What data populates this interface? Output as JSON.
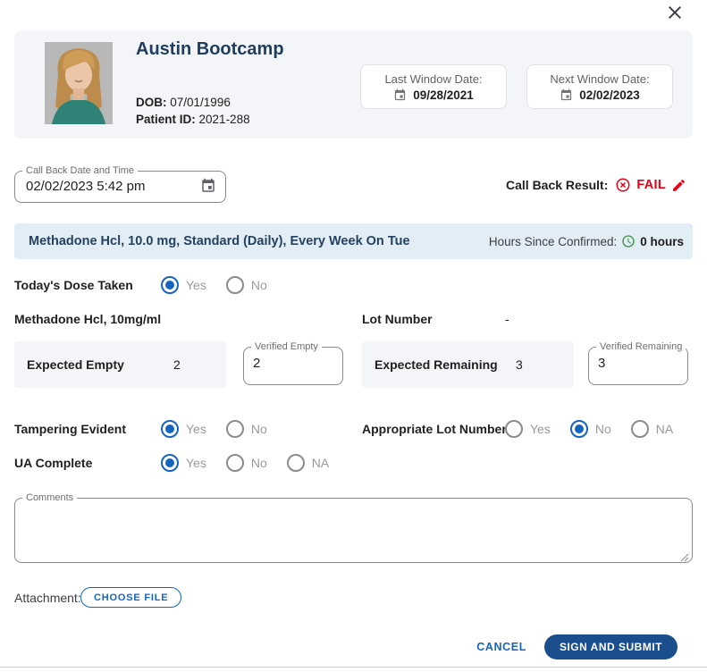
{
  "patient": {
    "name": "Austin Bootcamp",
    "dob_label": "DOB:",
    "dob_value": "07/01/1996",
    "patient_id_label": "Patient ID:",
    "patient_id_value": "2021-288",
    "last_window": {
      "label": "Last Window Date:",
      "date": "09/28/2021"
    },
    "next_window": {
      "label": "Next Window Date:",
      "date": "02/02/2023"
    }
  },
  "callback": {
    "datetime_label": "Call Back Date and Time",
    "datetime_value": "02/02/2023 5:42 pm",
    "result_label": "Call Back Result:",
    "result_value": "FAIL"
  },
  "dose": {
    "summary": "Methadone Hcl, 10.0 mg, Standard (Daily), Every Week On Tue",
    "hours_since_label": "Hours Since Confirmed:",
    "hours_since_value": "0 hours"
  },
  "form": {
    "dose_taken": {
      "label": "Today's Dose Taken",
      "options": [
        "Yes",
        "No"
      ],
      "selected": "Yes"
    },
    "medication_label": "Methadone Hcl, 10mg/ml",
    "lot_number_label": "Lot Number",
    "lot_number_value": "-",
    "expected_empty": {
      "label": "Expected Empty",
      "value": "2"
    },
    "verified_empty": {
      "label": "Verified Empty",
      "value": "2"
    },
    "expected_remaining": {
      "label": "Expected Remaining",
      "value": "3"
    },
    "verified_remaining": {
      "label": "Verified Remaining",
      "value": "3"
    },
    "tampering": {
      "label": "Tampering Evident",
      "options": [
        "Yes",
        "No"
      ],
      "selected": "Yes"
    },
    "appropriate_lot": {
      "label": "Appropriate Lot Number",
      "options": [
        "Yes",
        "No",
        "NA"
      ],
      "selected": "No"
    },
    "ua_complete": {
      "label": "UA Complete",
      "options": [
        "Yes",
        "No",
        "NA"
      ],
      "selected": "Yes"
    },
    "comments_label": "Comments",
    "comments_value": "",
    "attachment_label": "Attachment:",
    "choose_file_label": "CHOOSE FILE"
  },
  "footer": {
    "cancel_label": "CANCEL",
    "submit_label": "SIGN AND SUBMIT"
  },
  "colors": {
    "navy_text": "#1e3d5f",
    "radio_blue": "#1565c0",
    "fail_red": "#e60012",
    "dose_bar_bg": "#e3edf6",
    "clock_green": "#388e3c",
    "submit_navy": "#1a4e8c",
    "header_card_bg": "#f4f5f8"
  }
}
